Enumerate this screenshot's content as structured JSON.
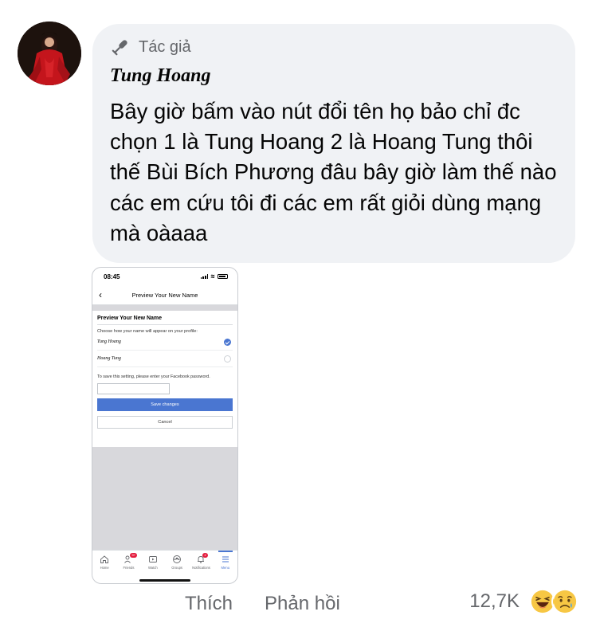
{
  "comment": {
    "author_badge": "Tác giả",
    "author_name": "Tung Hoang",
    "text": "Bây giờ bấm vào nút đổi tên họ bảo chỉ đc chọn 1 là Tung Hoang 2 là Hoang Tung thôi thế Bùi Bích Phương đâu bây giờ làm thế nào các em cứu tôi đi các em rất giỏi dùng mạng mà oàaaa",
    "avatar_icon": "profile-photo",
    "badge_icon": "microphone-icon"
  },
  "attachment": {
    "status_time": "08:45",
    "header_title": "Preview Your New Name",
    "card_title": "Preview Your New Name",
    "hint": "Choose how your name will appear on your profile:",
    "options": [
      {
        "label": "Tung Hoang",
        "selected": true
      },
      {
        "label": "Hoang Tung",
        "selected": false
      }
    ],
    "password_label": "To save this setting, please enter your Facebook password.",
    "save_label": "Save changes",
    "cancel_label": "Cancel",
    "tabs": [
      {
        "label": "Home",
        "icon": "home-icon"
      },
      {
        "label": "Friends",
        "icon": "friends-icon",
        "badge": "9+"
      },
      {
        "label": "Watch",
        "icon": "watch-icon"
      },
      {
        "label": "Groups",
        "icon": "groups-icon"
      },
      {
        "label": "Notifications",
        "icon": "bell-icon",
        "badge": "2"
      },
      {
        "label": "Menu",
        "icon": "menu-icon",
        "active": true
      }
    ]
  },
  "actions": {
    "like": "Thích",
    "reply": "Phản hồi",
    "reaction_count": "12,7K",
    "reactions": [
      "laughing-emoji",
      "sad-emoji"
    ]
  },
  "colors": {
    "bubble_bg": "#f0f2f5",
    "secondary_text": "#65676b",
    "fb_blue": "#4a76d1",
    "avatar_dress": "#c4151c"
  }
}
